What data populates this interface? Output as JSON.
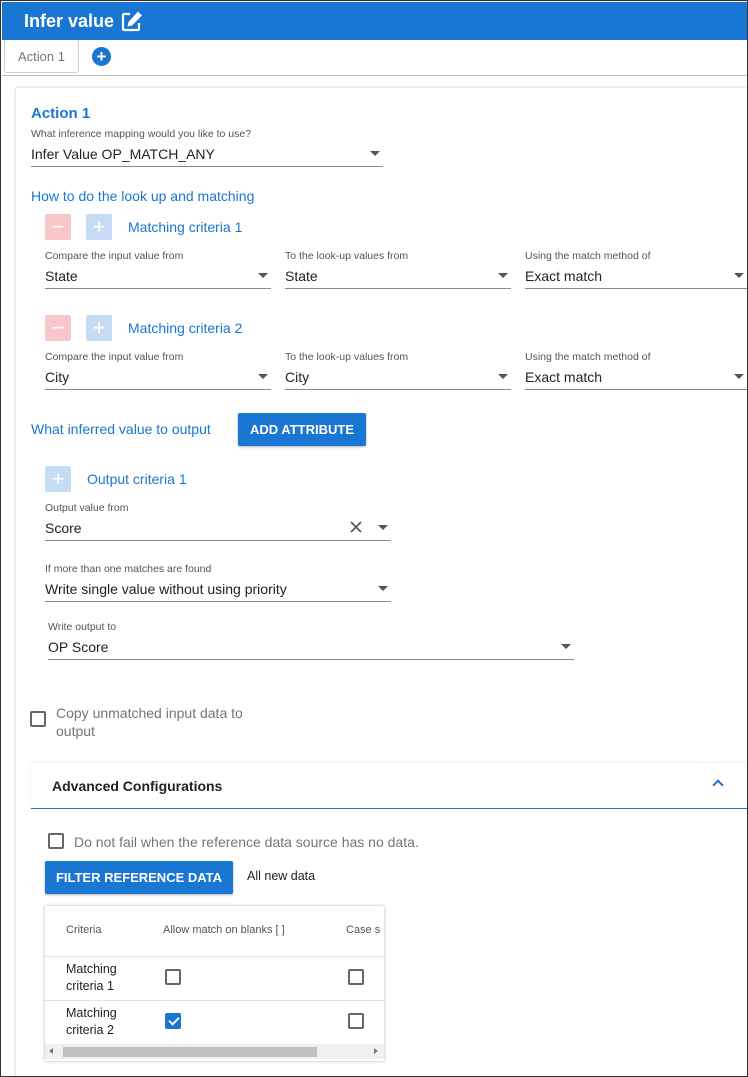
{
  "header": {
    "title": "Infer value",
    "icon": "edit-icon"
  },
  "tabs": {
    "items": [
      {
        "label": "Action 1"
      }
    ],
    "add_icon": "plus-circle-icon"
  },
  "action": {
    "title": "Action 1",
    "mapping_label": "What inference mapping would you like to use?",
    "mapping_value": "Infer Value OP_MATCH_ANY"
  },
  "lookup": {
    "heading": "How to do the look up and matching",
    "criteria": [
      {
        "title": "Matching criteria 1",
        "input_label": "Compare the input value from",
        "input_value": "State",
        "lookup_label": "To the look-up values from",
        "lookup_value": "State",
        "method_label": "Using the match method of",
        "method_value": "Exact match"
      },
      {
        "title": "Matching criteria 2",
        "input_label": "Compare the input value from",
        "input_value": "City",
        "lookup_label": "To the look-up values from",
        "lookup_value": "City",
        "method_label": "Using the match method of",
        "method_value": "Exact match"
      }
    ]
  },
  "output": {
    "heading": "What inferred value to output",
    "add_attribute_label": "ADD ATTRIBUTE",
    "criteria_title": "Output criteria 1",
    "value_from_label": "Output value from",
    "value_from_value": "Score",
    "multi_label": "If more than one matches are found",
    "multi_value": "Write single value without using priority",
    "write_to_label": "Write output to",
    "write_to_value": "OP Score"
  },
  "copy_unmatched": {
    "label": "Copy unmatched input data to output",
    "checked": false
  },
  "advanced": {
    "title": "Advanced Configurations",
    "no_fail_label": "Do not fail when the reference data source has no data.",
    "no_fail_checked": false,
    "filter_button": "FILTER REFERENCE DATA",
    "filter_status": "All new data",
    "table": {
      "columns": [
        "Criteria",
        "Allow match on blanks [ ]",
        "Case s"
      ],
      "rows": [
        {
          "criteria": "Matching criteria 1",
          "allow_blanks": false,
          "case_sensitive": false
        },
        {
          "criteria": "Matching criteria 2",
          "allow_blanks": true,
          "case_sensitive": false
        }
      ]
    }
  },
  "colors": {
    "primary": "#1976d2",
    "remove_disabled": "#f7c7c9",
    "add_disabled": "#c6dcf5"
  }
}
